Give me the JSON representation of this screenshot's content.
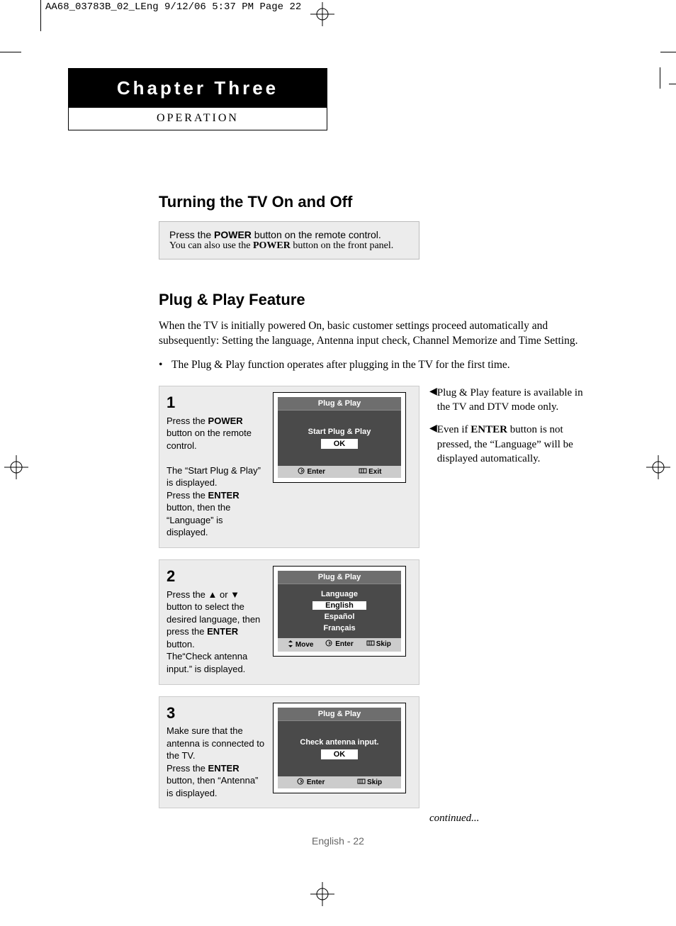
{
  "slug": "AA68_03783B_02_LEng  9/12/06  5:37 PM  Page 22",
  "chapter": {
    "title": "Chapter Three",
    "subtitle": "Operation"
  },
  "s1": {
    "heading": "Turning the TV On and Off",
    "line1_a": "Press the ",
    "line1_b": "POWER",
    "line1_c": "  button on the remote control.",
    "line2_a": "You can also use the ",
    "line2_b": "POWER",
    "line2_c": " button on the front panel."
  },
  "s2": {
    "heading": "Plug & Play Feature",
    "intro": "When the TV is initially powered On, basic customer settings proceed automatically and subsequently: Setting the language, Antenna input check, Channel Memorize and Time Setting.",
    "bullet": "The Plug & Play function operates after plugging in the TV for the first time.",
    "notes": [
      {
        "text_a": "Plug & Play feature is available in the TV and DTV mode only."
      },
      {
        "text_a": "Even if ",
        "bold": "ENTER",
        "text_b": " button is not pressed, the “Language” will be displayed automatically."
      }
    ]
  },
  "steps": [
    {
      "num": "1",
      "text_html": "Press the <b>POWER</b> button on the remote control.<br><br>The “Start Plug & Play” is displayed.<br>Press the <b>ENTER</b> button, then the “Language” is displayed.",
      "screen": {
        "title": "Plug & Play",
        "msg": "Start Plug & Play",
        "ok": "OK",
        "footer": [
          {
            "icon": "enter",
            "label": "Enter"
          },
          {
            "icon": "exit",
            "label": "Exit"
          }
        ]
      }
    },
    {
      "num": "2",
      "text_html": "Press the ▲ or ▼ button to select the desired language, then press the <b>ENTER</b> button.<br>The“Check antenna input.” is displayed.",
      "screen": {
        "title": "Plug & Play",
        "subtitle": "Language",
        "options": [
          "English",
          "Español",
          "Français"
        ],
        "selected": 0,
        "footer": [
          {
            "icon": "move",
            "label": "Move"
          },
          {
            "icon": "enter",
            "label": "Enter"
          },
          {
            "icon": "skip",
            "label": "Skip"
          }
        ]
      }
    },
    {
      "num": "3",
      "text_html": "Make sure that the antenna is connected to the TV.<br>Press the <b>ENTER</b> button, then “Antenna” is displayed.",
      "screen": {
        "title": "Plug & Play",
        "msg": "Check antenna input.",
        "ok": "OK",
        "footer": [
          {
            "icon": "enter",
            "label": "Enter"
          },
          {
            "icon": "skip",
            "label": "Skip"
          }
        ]
      }
    }
  ],
  "continued": "continued...",
  "footer": "English - 22"
}
